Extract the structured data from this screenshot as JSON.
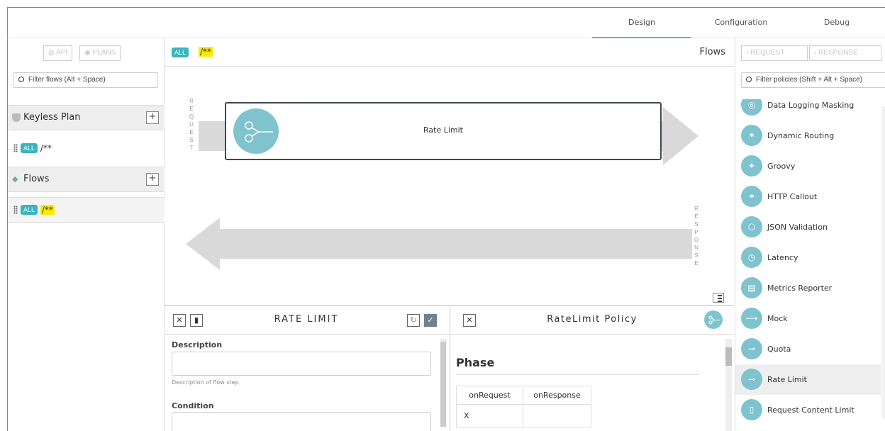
{
  "tabs": [
    {
      "label": "Design"
    },
    {
      "label": "Configuration"
    },
    {
      "label": "Debug"
    }
  ],
  "left": {
    "api_label": "API",
    "plans_label": "PLANS",
    "filter_placeholder": "Filter flows (Alt + Space)",
    "plan_section": "Keyless Plan",
    "plan_flow": {
      "badge": "ALL",
      "path": "/**"
    },
    "flows_section": "Flows",
    "flows_flow": {
      "badge": "ALL",
      "path": "/**"
    }
  },
  "center": {
    "badge": "ALL",
    "path": "/**",
    "title": "Flows",
    "request_letters": [
      "R",
      "E",
      "Q",
      "U",
      "E",
      "S",
      "T"
    ],
    "response_letters": [
      "R",
      "E",
      "S",
      "P",
      "O",
      "N",
      "S",
      "E"
    ],
    "step_name": "Rate Limit"
  },
  "step_panel": {
    "title": "RATE LIMIT",
    "description_label": "Description",
    "description_help": "Description of flow step",
    "condition_label": "Condition"
  },
  "policy_panel": {
    "title": "RateLimit Policy",
    "phase_heading": "Phase",
    "columns": [
      "onRequest",
      "onResponse"
    ],
    "rows": [
      [
        "X",
        ""
      ]
    ]
  },
  "right": {
    "request_label": "REQUEST",
    "response_label": "RESPONSE",
    "filter_placeholder": "Filter policies (Shift + Alt + Space)",
    "policies": [
      {
        "label": "Data Logging Masking",
        "icon": "mask-icon"
      },
      {
        "label": "Dynamic Routing",
        "icon": "routing-icon"
      },
      {
        "label": "Groovy",
        "icon": "groovy-icon"
      },
      {
        "label": "HTTP Callout",
        "icon": "callout-icon"
      },
      {
        "label": "JSON Validation",
        "icon": "json-validation-icon"
      },
      {
        "label": "Latency",
        "icon": "latency-icon"
      },
      {
        "label": "Metrics Reporter",
        "icon": "metrics-icon"
      },
      {
        "label": "Mock",
        "icon": "mock-icon"
      },
      {
        "label": "Quota",
        "icon": "quota-icon"
      },
      {
        "label": "Rate Limit",
        "icon": "rate-limit-icon"
      },
      {
        "label": "Request Content Limit",
        "icon": "content-limit-icon"
      }
    ],
    "selected": "Rate Limit"
  },
  "colors": {
    "accent": "#37b5c0",
    "highlight": "#ffeb00",
    "policy_icon": "#7fc3cf"
  }
}
